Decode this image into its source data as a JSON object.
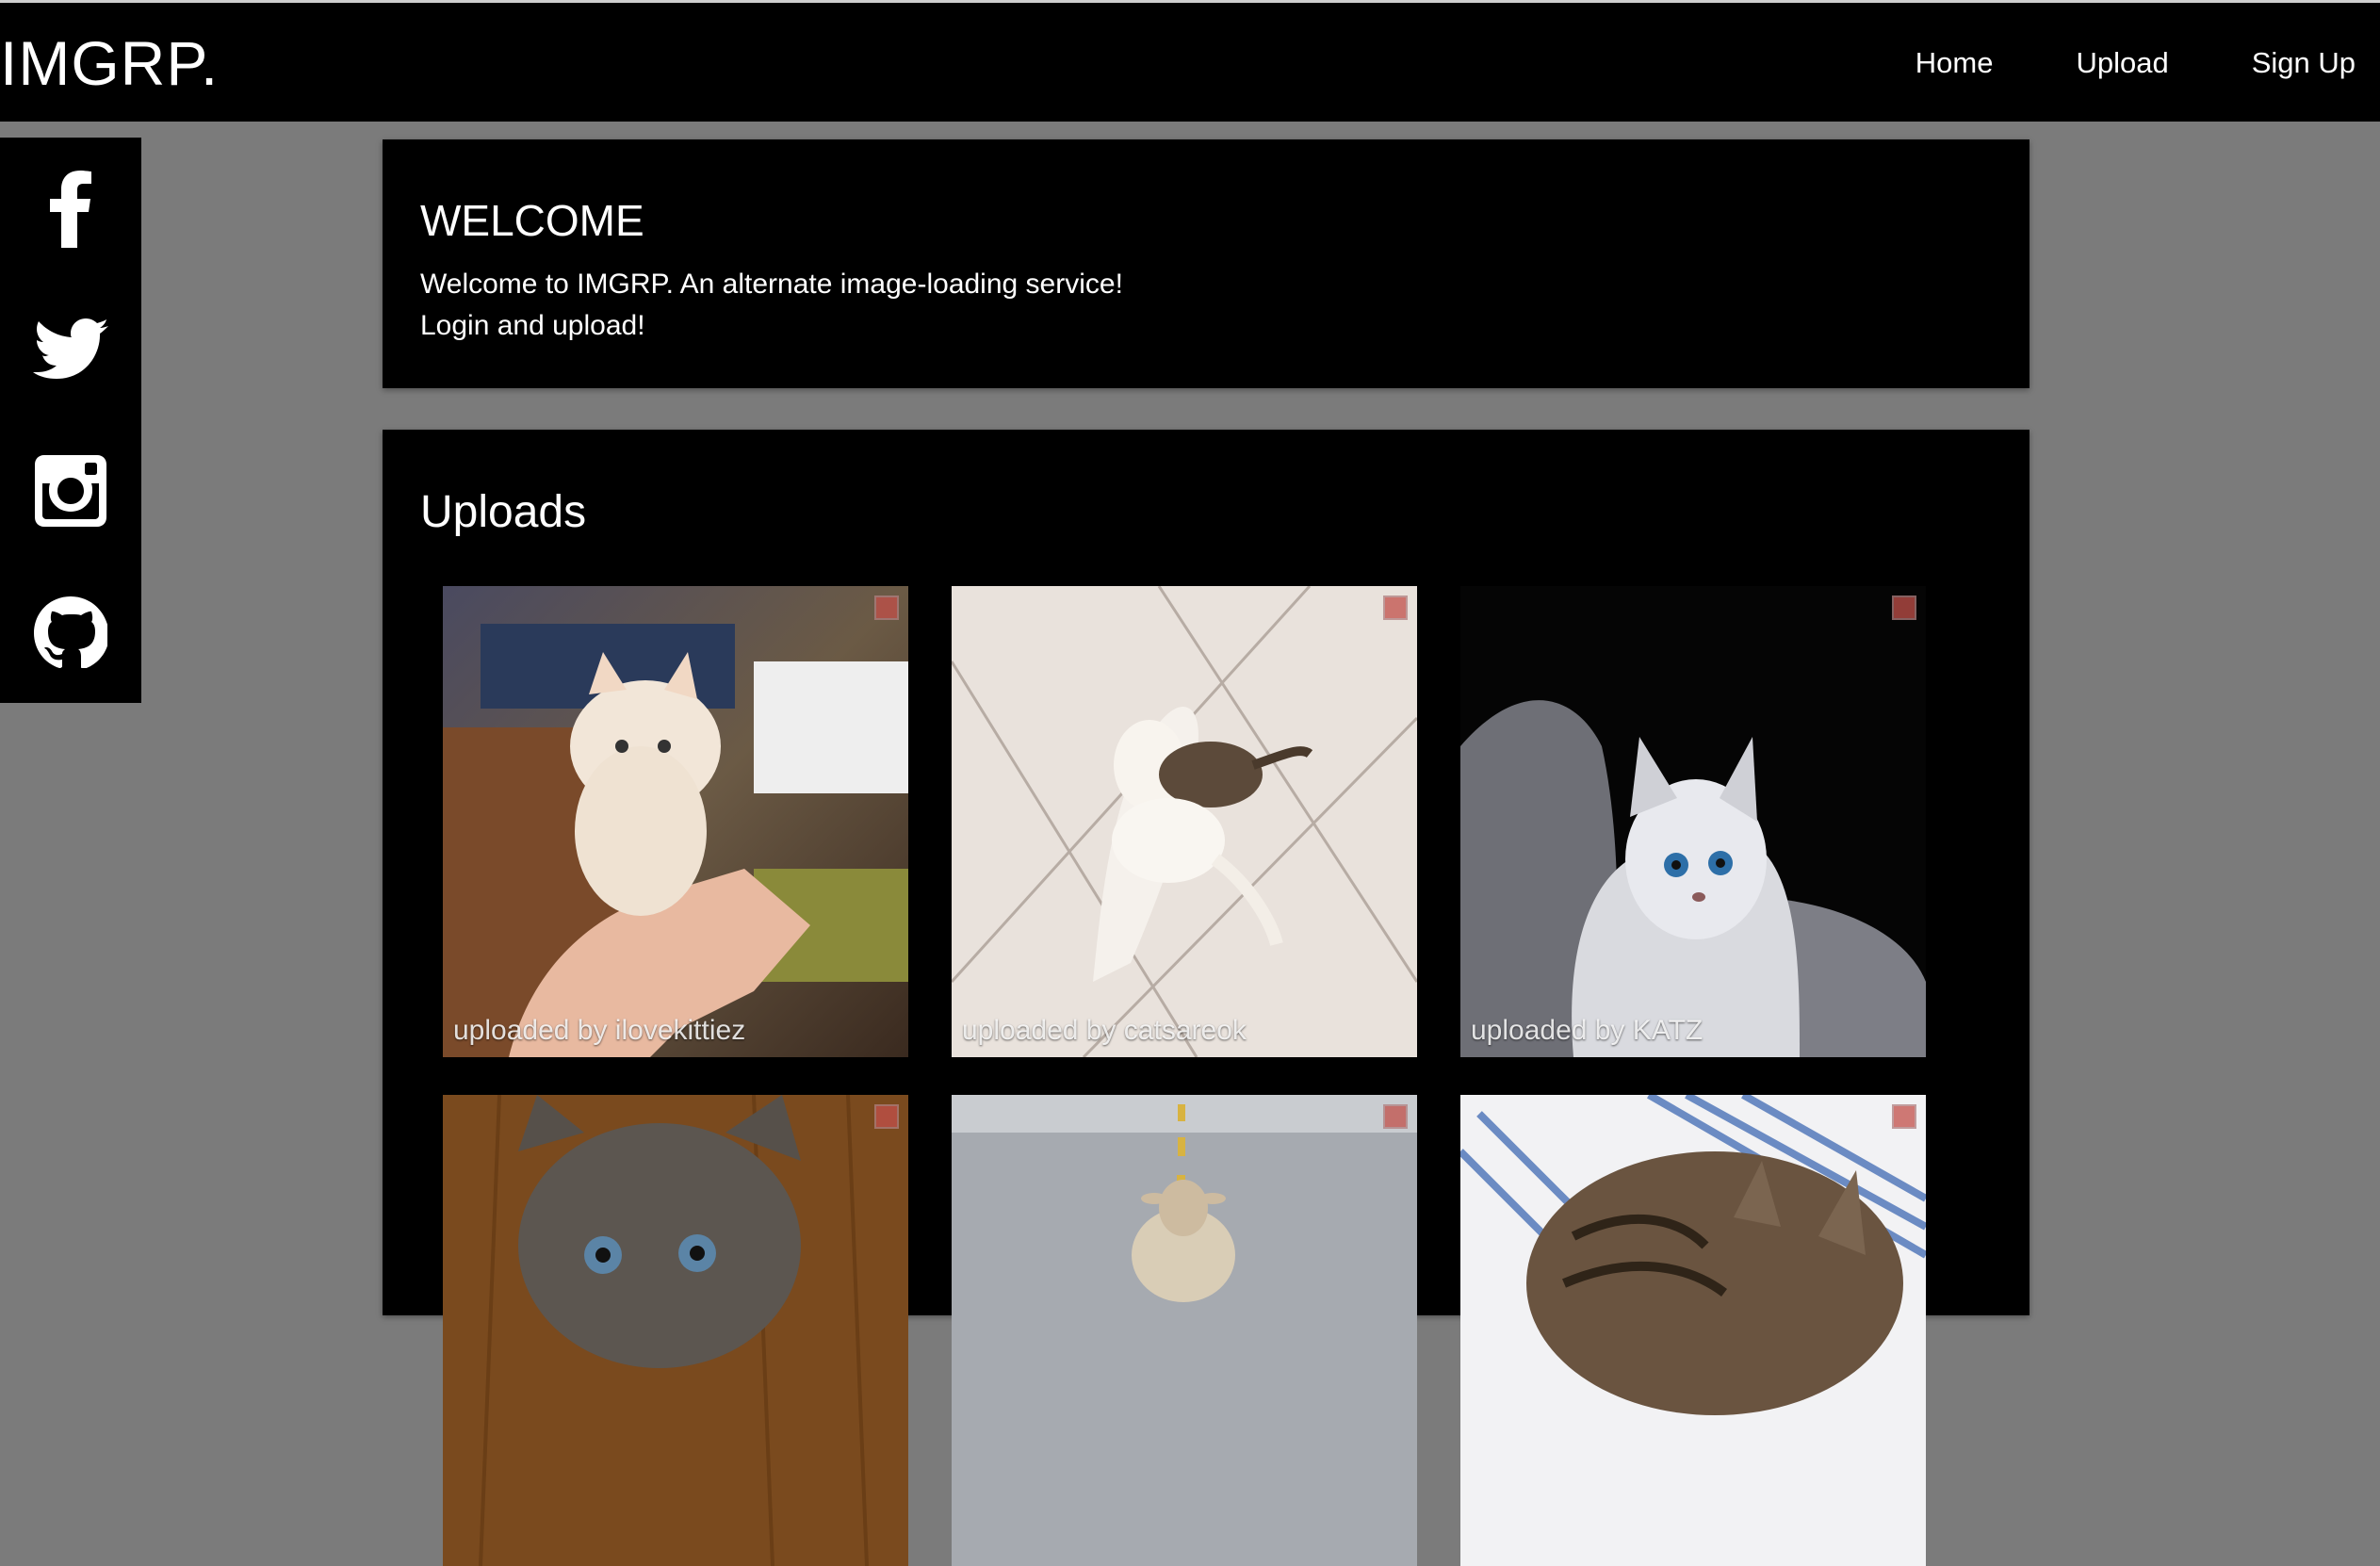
{
  "app": {
    "brand": "IMGRP."
  },
  "nav": {
    "home": "Home",
    "upload": "Upload",
    "signup": "Sign Up"
  },
  "social": [
    "facebook-icon",
    "twitter-icon",
    "instagram-icon",
    "github-icon"
  ],
  "welcome": {
    "title": "WELCOME",
    "line1": "Welcome to IMGRP. An alternate image-loading service!",
    "line2": "Login and upload!"
  },
  "uploads": {
    "title": "Uploads",
    "items": [
      {
        "caption": "uploaded by ilovekittiez",
        "scene": "kitten held in hands"
      },
      {
        "caption": "uploaded by catsareok",
        "scene": "kittens on tile floor"
      },
      {
        "caption": "uploaded by KATZ",
        "scene": "white kitten in dark room"
      },
      {
        "caption": "",
        "scene": "gray kitten close-up"
      },
      {
        "caption": "",
        "scene": "sheep on road"
      },
      {
        "caption": "",
        "scene": "tabby kitten on pillow"
      }
    ]
  },
  "colors": {
    "background": "#7b7b7b",
    "panel": "#000000",
    "text": "#ffffff"
  }
}
